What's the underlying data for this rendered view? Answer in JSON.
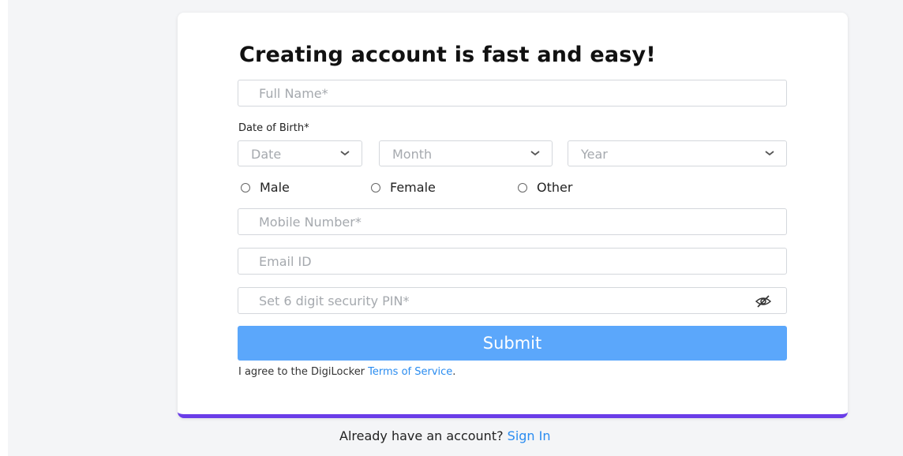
{
  "form": {
    "title": "Creating account is fast and easy!",
    "full_name_placeholder": "Full Name*",
    "dob_label": "Date of Birth*",
    "date_select": "Date",
    "month_select": "Month",
    "year_select": "Year",
    "gender_options": [
      "Male",
      "Female",
      "Other"
    ],
    "mobile_placeholder": "Mobile Number*",
    "email_placeholder": "Email ID",
    "pin_placeholder": "Set 6 digit security PIN*",
    "pin_toggle_icon": "eye-slash-icon",
    "submit_label": "Submit",
    "agree_text": "I agree to the DigiLocker ",
    "terms_link": "Terms of Service",
    "agree_end": "."
  },
  "footer": {
    "signin_prompt": "Already have an account? ",
    "signin_link": "Sign In"
  },
  "colors": {
    "accent": "#5ba7fb",
    "link": "#2a8cf0",
    "card_bottom_border": "#6a3de8"
  }
}
